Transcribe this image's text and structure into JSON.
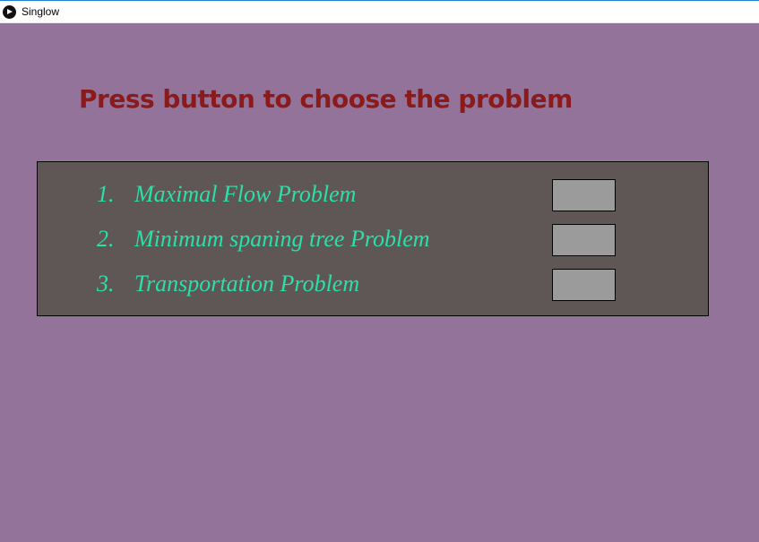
{
  "window": {
    "title": "Singlow"
  },
  "heading": "Press button to choose the problem",
  "problems": [
    {
      "number": "1.",
      "label": "Maximal Flow Problem"
    },
    {
      "number": "2.",
      "label": "Minimum spaning tree Problem"
    },
    {
      "number": "3.",
      "label": "Transportation Problem"
    }
  ],
  "colors": {
    "background": "#94739a",
    "heading": "#8b1a1a",
    "panel": "#5f5755",
    "item_text": "#2be0a8",
    "button": "#9b9b9b"
  }
}
